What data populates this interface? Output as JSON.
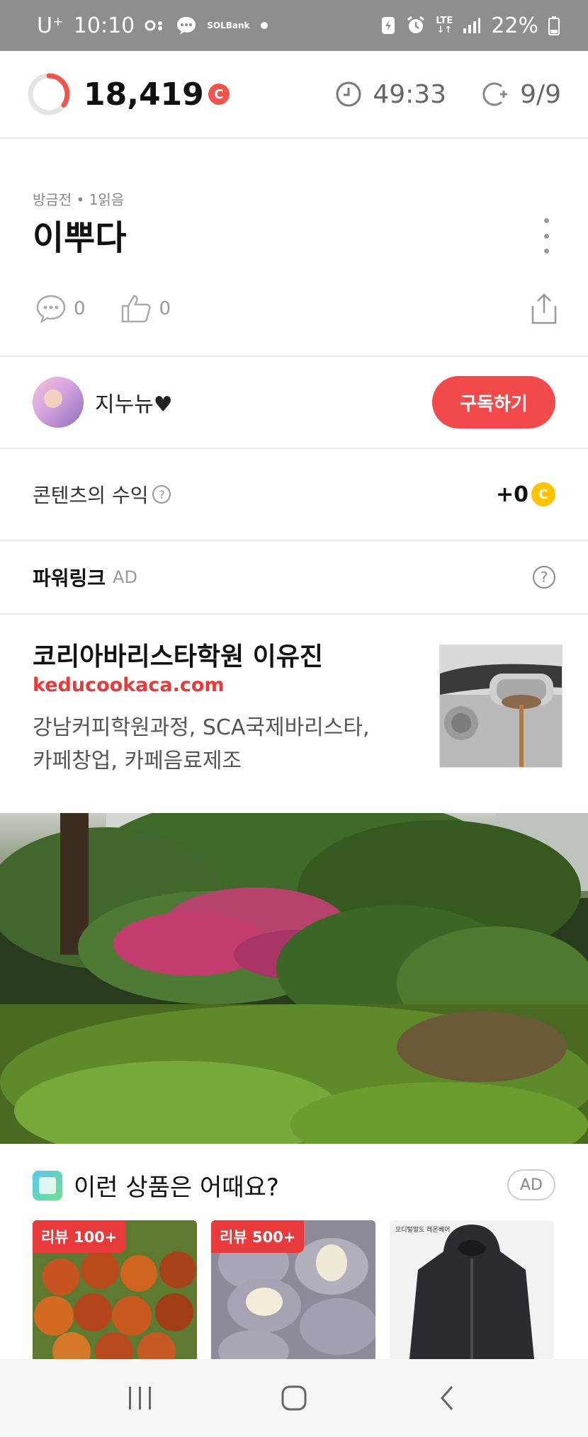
{
  "status_bar": {
    "carrier": "U⁺",
    "time": "10:10",
    "sol_line1": "SOL",
    "sol_line2": "Bank",
    "network": "LTE",
    "battery": "22%"
  },
  "header": {
    "points": "18,419",
    "coin_symbol": "C",
    "timer": "49:33",
    "read_count": "9/9",
    "progress_fraction": 0.35,
    "accent_color": "#f2544c"
  },
  "post": {
    "meta": "방금전 • 1읽음",
    "title": "이뿌다",
    "comment_count": "0",
    "like_count": "0"
  },
  "author": {
    "name": "지누뉴♥",
    "subscribe_label": "구독하기"
  },
  "revenue": {
    "label": "콘텐츠의 수익",
    "help": "?",
    "value": "+0",
    "coin_symbol": "C"
  },
  "powerlink": {
    "title": "파워링크",
    "ad_label": "AD",
    "help": "?"
  },
  "ad": {
    "title": "코리아바리스타학원 이유진",
    "url": "keducookaca.com",
    "description_line1": "강남커피학원과정, SCA국제바리스타,",
    "description_line2": "카페창업, 카페음료제조"
  },
  "products": {
    "title": "이런 상품은 어때요?",
    "ad_label": "AD",
    "items": [
      {
        "badge": "리뷰 100+"
      },
      {
        "badge": "리뷰 500+"
      },
      {
        "badge": "",
        "caption": "오디털말도 레몬베어"
      }
    ]
  }
}
